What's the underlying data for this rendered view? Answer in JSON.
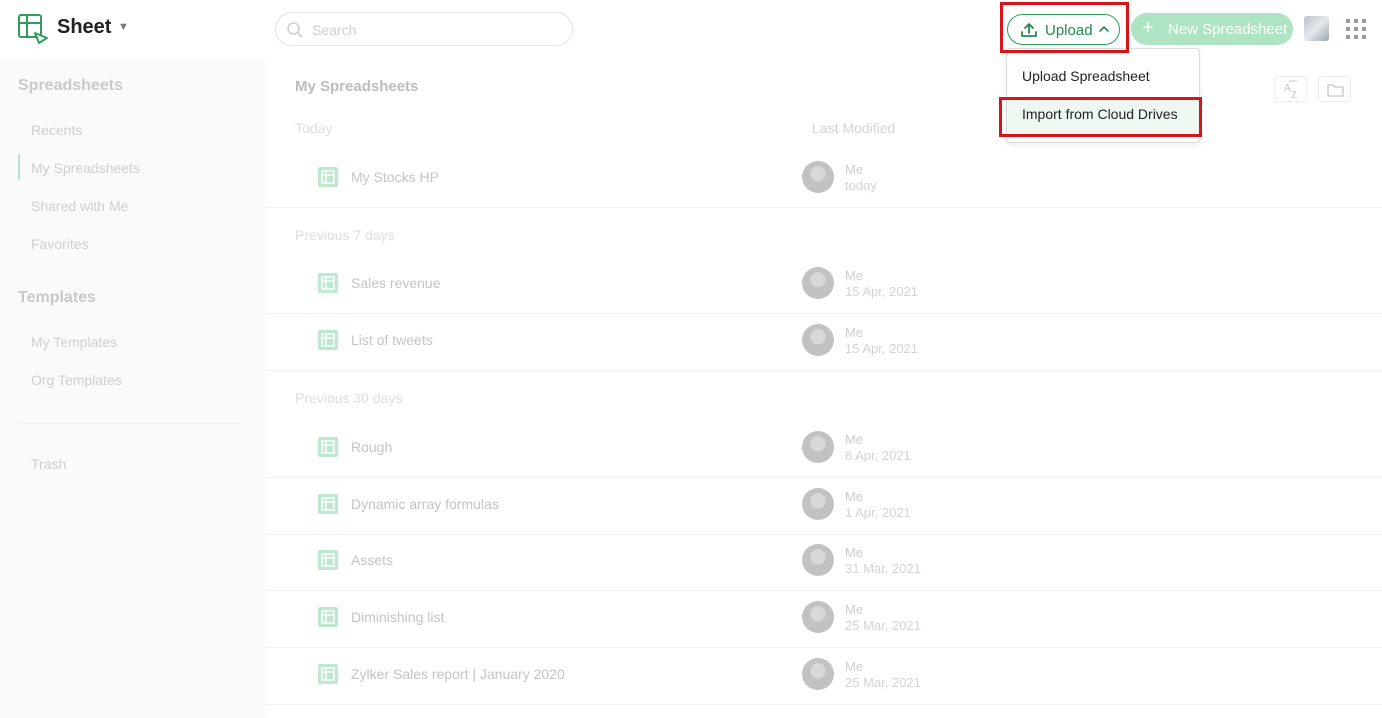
{
  "header": {
    "app_name": "Sheet",
    "search_placeholder": "Search",
    "upload_label": "Upload",
    "new_spreadsheet_label": "New Spreadsheet"
  },
  "upload_menu": {
    "items": [
      "Upload Spreadsheet",
      "Import from Cloud Drives"
    ]
  },
  "sidebar": {
    "spreadsheets_heading": "Spreadsheets",
    "spreadsheet_items": [
      "Recents",
      "My Spreadsheets",
      "Shared with Me",
      "Favorites"
    ],
    "templates_heading": "Templates",
    "template_items": [
      "My Templates",
      "Org Templates"
    ],
    "trash_label": "Trash",
    "active_item": "My Spreadsheets"
  },
  "main": {
    "title": "My Spreadsheets",
    "last_modified_header": "Last Modified",
    "sections": [
      {
        "label": "Today",
        "files": [
          {
            "name": "My Stocks HP",
            "owner": "Me",
            "modified": "today"
          }
        ]
      },
      {
        "label": "Previous 7 days",
        "files": [
          {
            "name": "Sales revenue",
            "owner": "Me",
            "modified": "15 Apr, 2021"
          },
          {
            "name": "List of tweets",
            "owner": "Me",
            "modified": "15 Apr, 2021"
          }
        ]
      },
      {
        "label": "Previous 30 days",
        "files": [
          {
            "name": "Rough",
            "owner": "Me",
            "modified": "8 Apr, 2021"
          },
          {
            "name": "Dynamic array formulas",
            "owner": "Me",
            "modified": "1 Apr, 2021"
          },
          {
            "name": "Assets",
            "owner": "Me",
            "modified": "31 Mar, 2021"
          },
          {
            "name": "Diminishing list",
            "owner": "Me",
            "modified": "25 Mar, 2021"
          },
          {
            "name": "Zylker Sales report | January 2020",
            "owner": "Me",
            "modified": "25 Mar, 2021"
          }
        ]
      }
    ]
  },
  "colors": {
    "accent": "#2e9e5b",
    "new_button": "#aee3c4",
    "highlight": "#d7141a"
  }
}
